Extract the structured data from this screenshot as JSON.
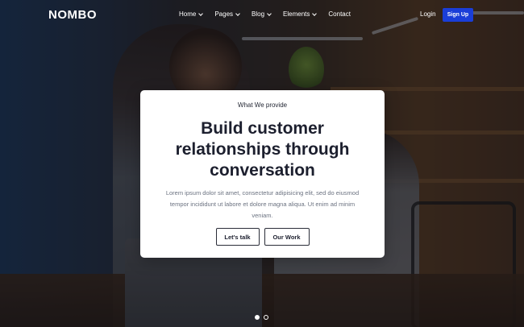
{
  "brand": {
    "logo_text": "NOMBO"
  },
  "nav": {
    "items": [
      {
        "label": "Home",
        "has_dropdown": true
      },
      {
        "label": "Pages",
        "has_dropdown": true
      },
      {
        "label": "Blog",
        "has_dropdown": true
      },
      {
        "label": "Elements",
        "has_dropdown": true
      },
      {
        "label": "Contact",
        "has_dropdown": false
      }
    ],
    "login_label": "Login",
    "signup_label": "Sign Up",
    "signup_color": "#1a3ed8"
  },
  "hero": {
    "eyebrow": "What We provide",
    "headline": "Build customer relationships through conversation",
    "description": "Lorem ipsum dolor sit amet, consectetur adipisicing elit, sed do eiusmod tempor incididunt ut labore et dolore magna aliqua. Ut enim ad minim veniam.",
    "primary_button": "Let's talk",
    "secondary_button": "Our Work"
  },
  "slider": {
    "dot_count": 2,
    "active_index": 0
  }
}
